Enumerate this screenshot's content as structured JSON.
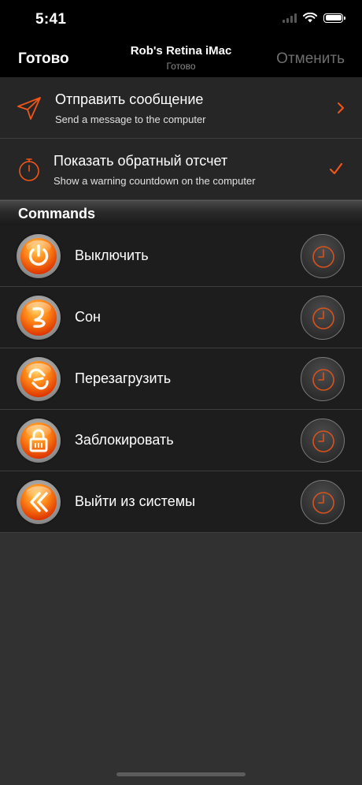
{
  "status_bar": {
    "time": "5:41"
  },
  "nav": {
    "left_button": "Готово",
    "title": "Rob's Retina iMac",
    "subtitle": "Готово",
    "right_button": "Отменить"
  },
  "options": [
    {
      "title": "Отправить сообщение",
      "subtitle": "Send a message to the computer",
      "icon": "paper-plane-icon",
      "accessory": "chevron-right-icon"
    },
    {
      "title": "Показать обратный отсчет",
      "subtitle": "Show a warning countdown on the computer",
      "icon": "stopwatch-icon",
      "accessory": "checkmark-icon"
    }
  ],
  "section": {
    "title": "Commands"
  },
  "commands": [
    {
      "label": "Выключить",
      "icon": "power-icon"
    },
    {
      "label": "Сон",
      "icon": "sleep-icon"
    },
    {
      "label": "Перезагрузить",
      "icon": "restart-icon"
    },
    {
      "label": "Заблокировать",
      "icon": "lock-icon"
    },
    {
      "label": "Выйти из системы",
      "icon": "logout-icon"
    }
  ],
  "colors": {
    "accent": "#f0561a",
    "background": "#313131",
    "bar": "#000000",
    "row": "#262626",
    "command_row": "#1d1d1d",
    "muted": "#6e6e6e"
  }
}
